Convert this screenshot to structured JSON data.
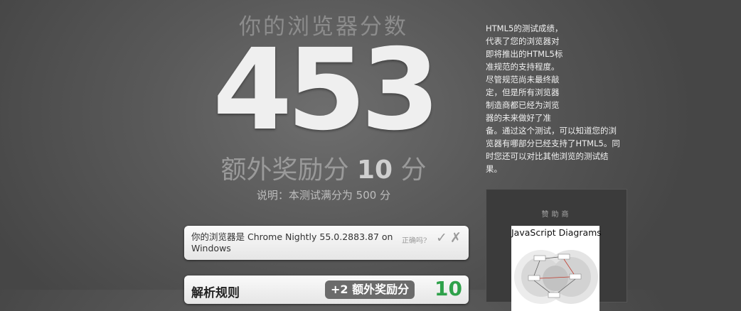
{
  "main": {
    "heading": "你的浏览器分数",
    "score": "453",
    "bonus_prefix": "额外奖励分",
    "bonus_value": "10",
    "bonus_suffix": "分",
    "note": "说明：本测试满分为 500 分"
  },
  "browser_card": {
    "text": "你的浏览器是 Chrome Nightly 55.0.2883.87 on Windows",
    "correct_question": "正确吗?",
    "check_icon": "✓",
    "x_icon": "✗"
  },
  "parse_card": {
    "title": "解析规则",
    "badge": "+2 额外奖励分",
    "score": "10"
  },
  "description": {
    "lines": [
      "HTML5的测试成绩，",
      "代表了您的浏览器对",
      "即将推出的HTML5标",
      "准规范的支持程度。",
      "尽管规范尚未最终敲",
      "定，但是所有浏览器",
      "制造商都已经为浏览",
      "器的未来做好了准",
      "备。通过这个测试，可以知道您的浏",
      "览器有哪部分已经支持了HTML5。同",
      "时您还可以对比其他浏览的测试结",
      "果。"
    ]
  },
  "sponsor": {
    "title": "赞助商",
    "ad_title": "JavaScript Diagrams"
  },
  "colors": {
    "accent_green": "#2ea14a",
    "badge_gray": "#6b6b6b"
  }
}
